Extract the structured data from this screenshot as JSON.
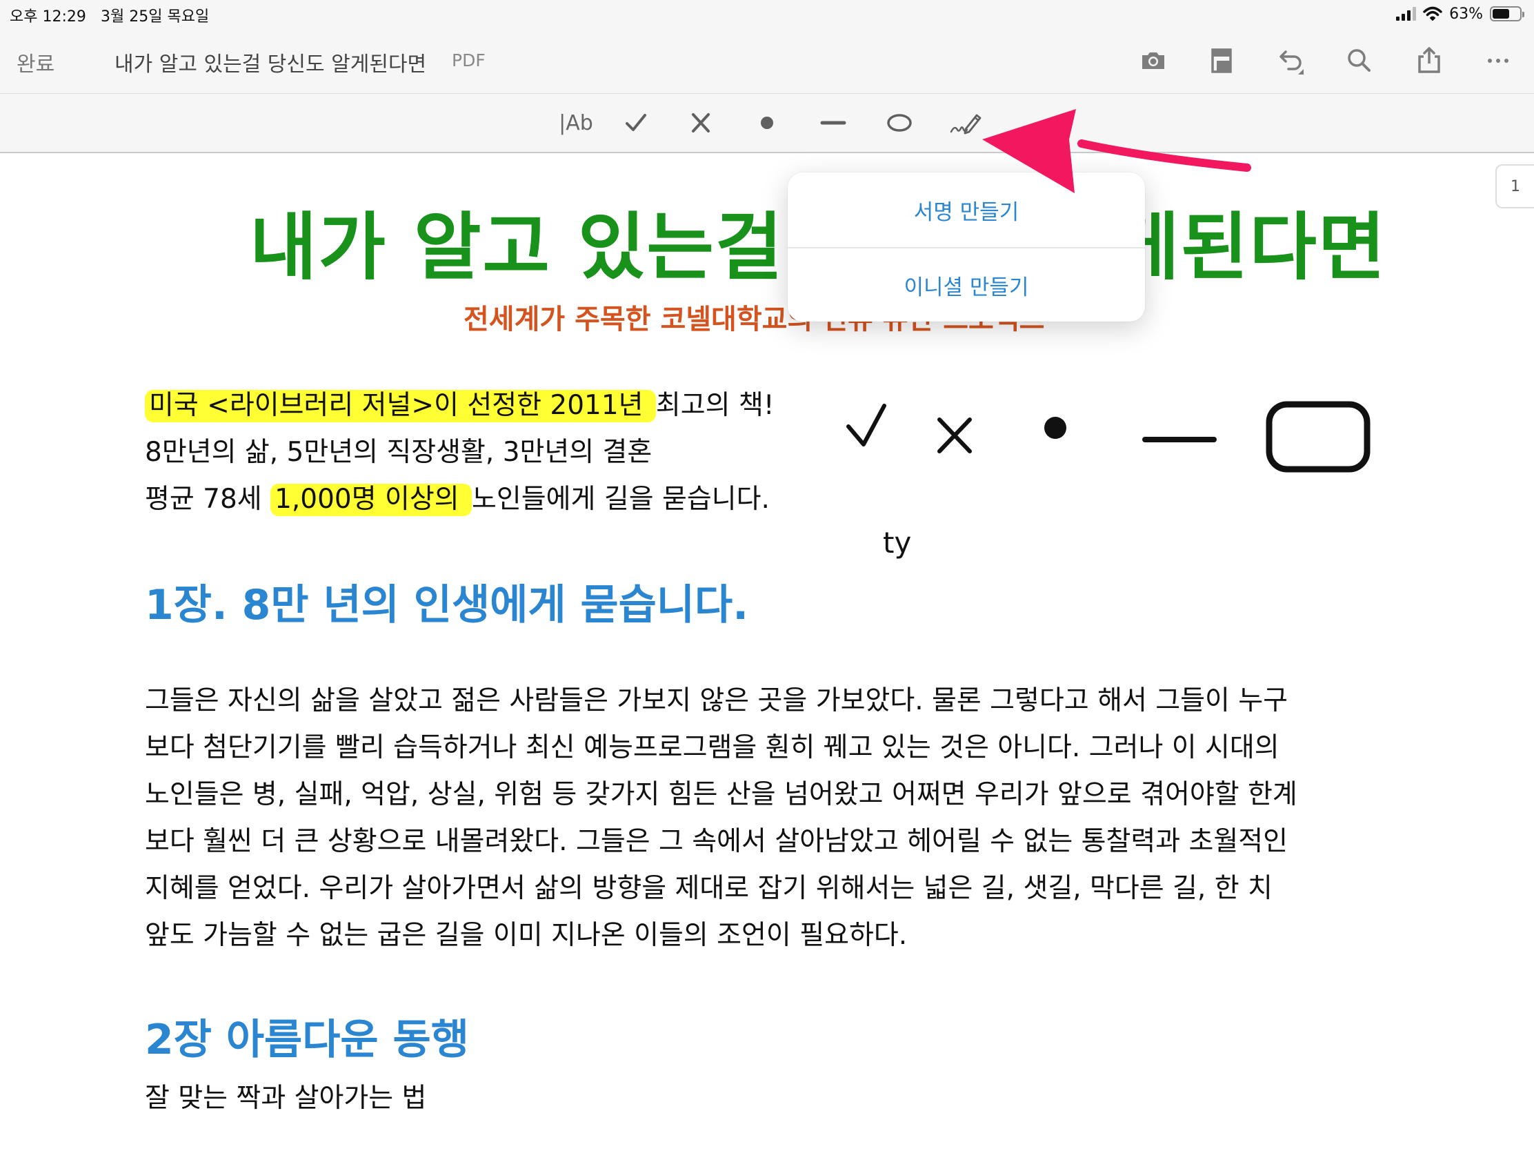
{
  "status_bar": {
    "time": "오후 12:29",
    "date": "3월 25일 목요일",
    "battery": "63%",
    "battery_level": 0.63
  },
  "nav_bar": {
    "done_label": "완료",
    "title": "내가 알고 있는걸 당신도 알게된다면",
    "file_type": "PDF",
    "icons": [
      "camera-icon",
      "page-layout-icon",
      "undo-icon",
      "search-icon",
      "share-icon",
      "more-icon"
    ]
  },
  "toolbar": {
    "text_tool": "|Ab",
    "tools": [
      "text-tool-icon",
      "checkmark-icon",
      "cross-icon",
      "dot-icon",
      "line-icon",
      "ellipse-icon",
      "signature-pen-icon"
    ]
  },
  "page_indicator": "1",
  "popover": {
    "items": [
      "서명 만들기",
      "이니셜 만들기"
    ]
  },
  "document": {
    "title": "내가 알고 있는걸 당신도 알게된다면",
    "subtitle": "전세계가 주목한 코넬대학교의 인류 유산 프로젝트",
    "intro": {
      "line1_highlight": "미국 <라이브러리 저널>이 선정한 2011년 ",
      "line1_rest": "최고의 책!",
      "line2": "8만년의 삶, 5만년의 직장생활, 3만년의 결혼",
      "line3_pre": "평균 78세 ",
      "line3_highlight": "1,000명 이상의 ",
      "line3_rest": "노인들에게 길을 묻습니다."
    },
    "chapter1_heading": "1장. 8만 년의 인생에게 묻습니다.",
    "chapter1_lines": [
      "그들은 자신의 삶을 살았고 젊은 사람들은 가보지 않은 곳을 가보았다. 물론 그렇다고 해서 그들이 누구",
      "보다 첨단기기를 빨리 습득하거나 최신 예능프로그램을 훤히 꿰고 있는 것은 아니다. 그러나 이 시대의",
      "노인들은 병, 실패, 억압, 상실, 위험 등 갖가지 힘든 산을 넘어왔고 어쩌면 우리가 앞으로 겪어야할 한계",
      "보다 훨씬 더 큰 상황으로 내몰려왔다. 그들은 그 속에서 살아남았고 헤어릴 수 없는 통찰력과 초월적인",
      "지혜를 얻었다. 우리가 살아가면서 삶의 방향을 제대로 잡기 위해서는 넓은 길, 샛길, 막다른 길, 한 치",
      "앞도 가늠할 수 없는 굽은 길을 이미 지나온 이들의 조언이 필요하다."
    ],
    "chapter2_heading": "2장 아름다운 동행",
    "chapter2_line": "잘 맞는 짝과 살아가는 법",
    "ink_text": "ty"
  },
  "colors": {
    "title_green": "#18921a",
    "subtitle_orange": "#d4531e",
    "heading_blue": "#2a86d1",
    "highlight_yellow": "#ffff33",
    "arrow_pink": "#f2185f"
  }
}
